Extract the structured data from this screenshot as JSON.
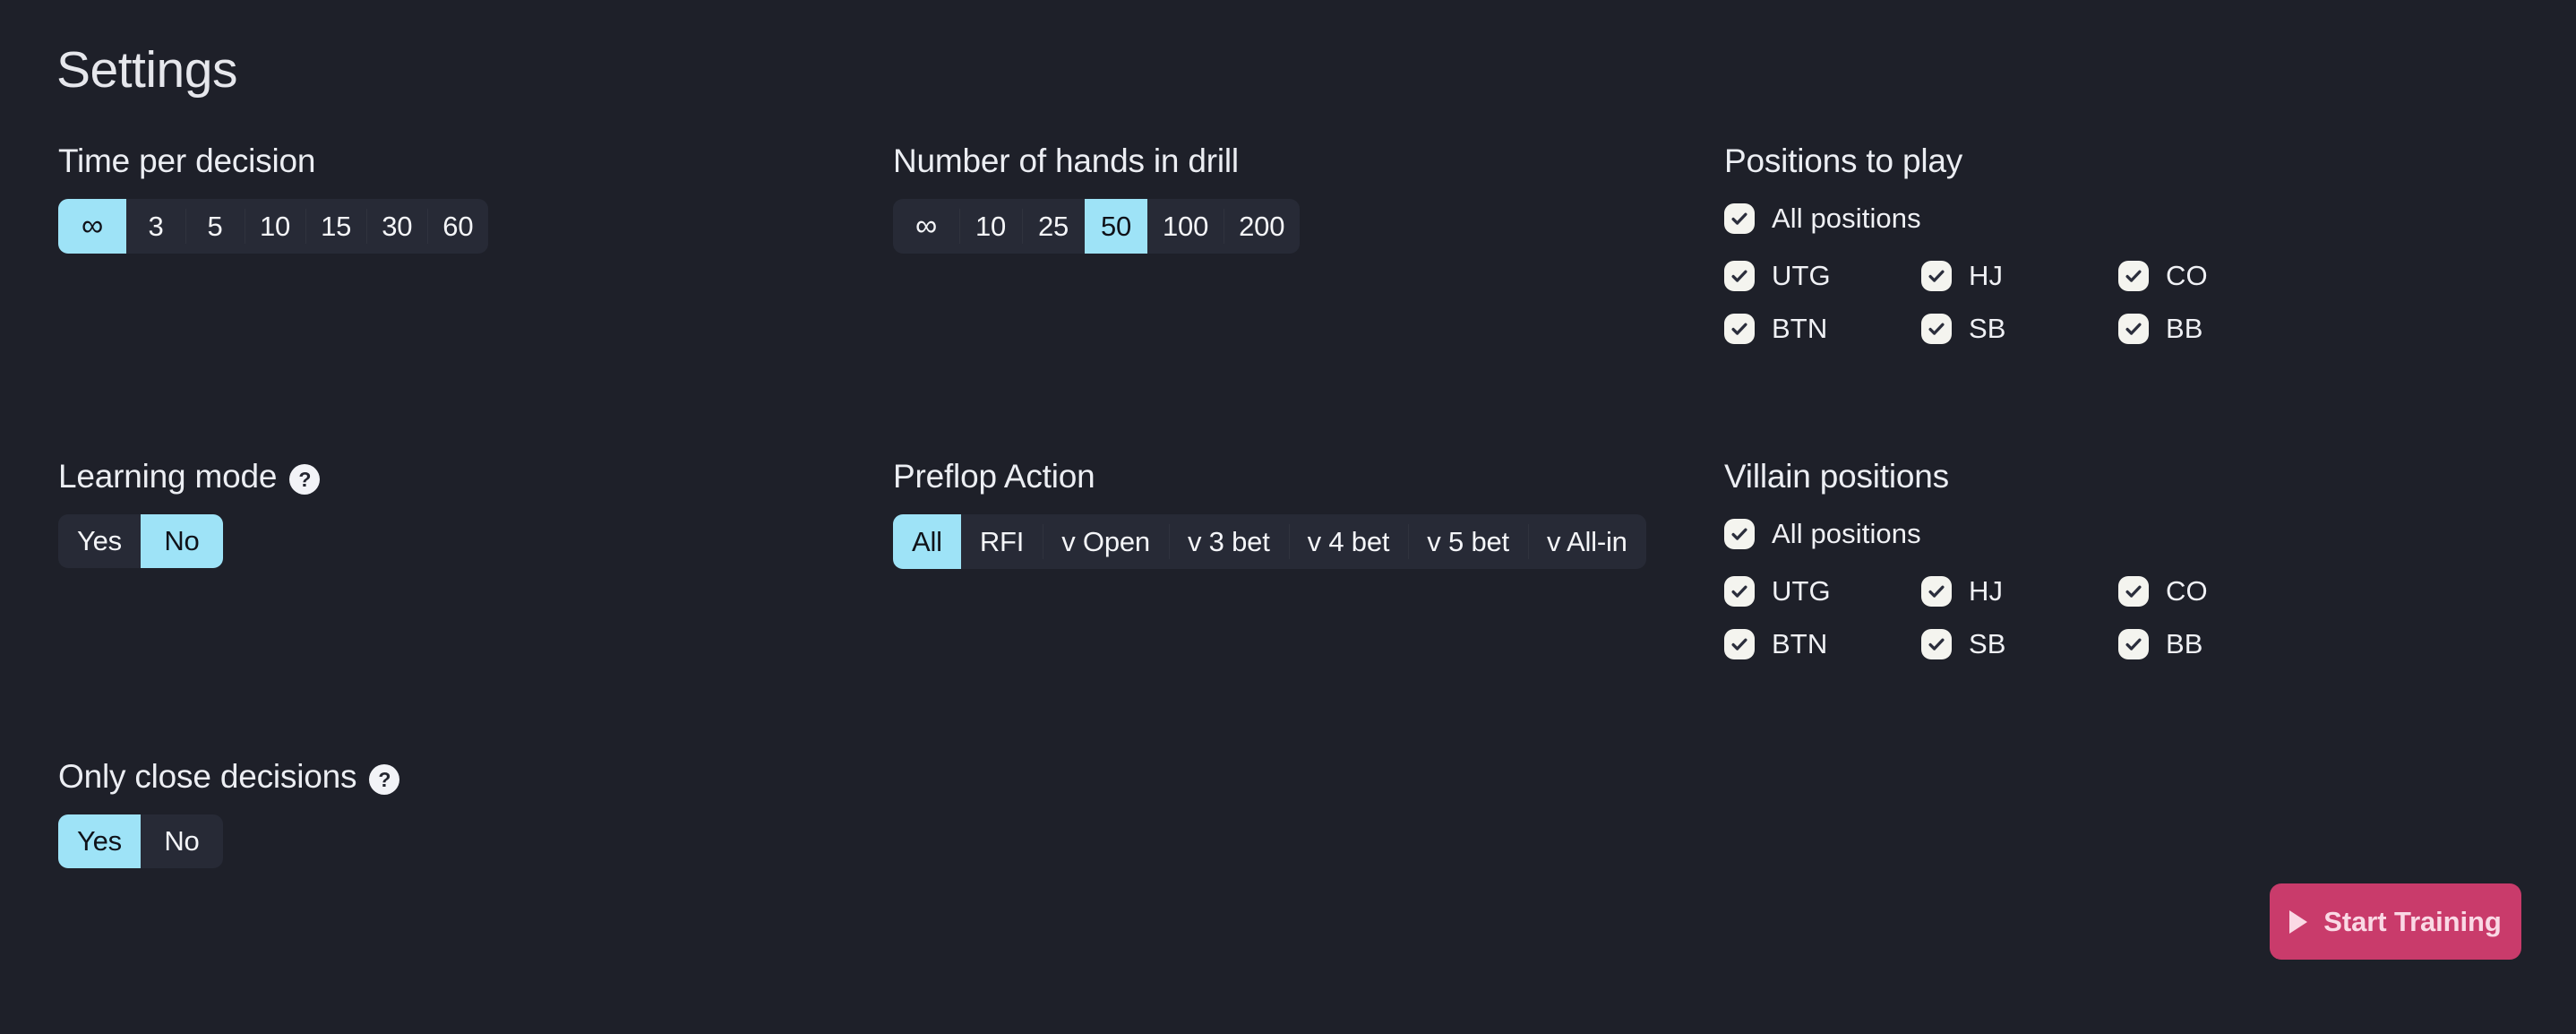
{
  "page": {
    "title": "Settings",
    "background_color": "#1e2029",
    "accent_color": "#9ee3f7",
    "button_color": "#c93b6b"
  },
  "time_per_decision": {
    "label": "Time per decision",
    "options": [
      "∞",
      "3",
      "5",
      "10",
      "15",
      "30",
      "60"
    ],
    "selected": "∞"
  },
  "hands_in_drill": {
    "label": "Number of hands in drill",
    "options": [
      "∞",
      "10",
      "25",
      "50",
      "100",
      "200"
    ],
    "selected": "50"
  },
  "positions_to_play": {
    "label": "Positions to play",
    "all_label": "All positions",
    "all_checked": true,
    "rows": [
      [
        {
          "label": "UTG",
          "checked": true
        },
        {
          "label": "HJ",
          "checked": true
        },
        {
          "label": "CO",
          "checked": true
        }
      ],
      [
        {
          "label": "BTN",
          "checked": true
        },
        {
          "label": "SB",
          "checked": true
        },
        {
          "label": "BB",
          "checked": true
        }
      ]
    ]
  },
  "learning_mode": {
    "label": "Learning mode",
    "help": "?",
    "options": [
      "Yes",
      "No"
    ],
    "selected": "No"
  },
  "preflop_action": {
    "label": "Preflop Action",
    "options": [
      "All",
      "RFI",
      "v Open",
      "v 3 bet",
      "v 4 bet",
      "v 5 bet",
      "v All-in"
    ],
    "selected": "All"
  },
  "villain_positions": {
    "label": "Villain positions",
    "all_label": "All positions",
    "all_checked": true,
    "rows": [
      [
        {
          "label": "UTG",
          "checked": true
        },
        {
          "label": "HJ",
          "checked": true
        },
        {
          "label": "CO",
          "checked": true
        }
      ],
      [
        {
          "label": "BTN",
          "checked": true
        },
        {
          "label": "SB",
          "checked": true
        },
        {
          "label": "BB",
          "checked": true
        }
      ]
    ]
  },
  "only_close_decisions": {
    "label": "Only close decisions",
    "help": "?",
    "options": [
      "Yes",
      "No"
    ],
    "selected": "Yes"
  },
  "start_button": {
    "label": "Start Training",
    "icon": "play-icon"
  }
}
